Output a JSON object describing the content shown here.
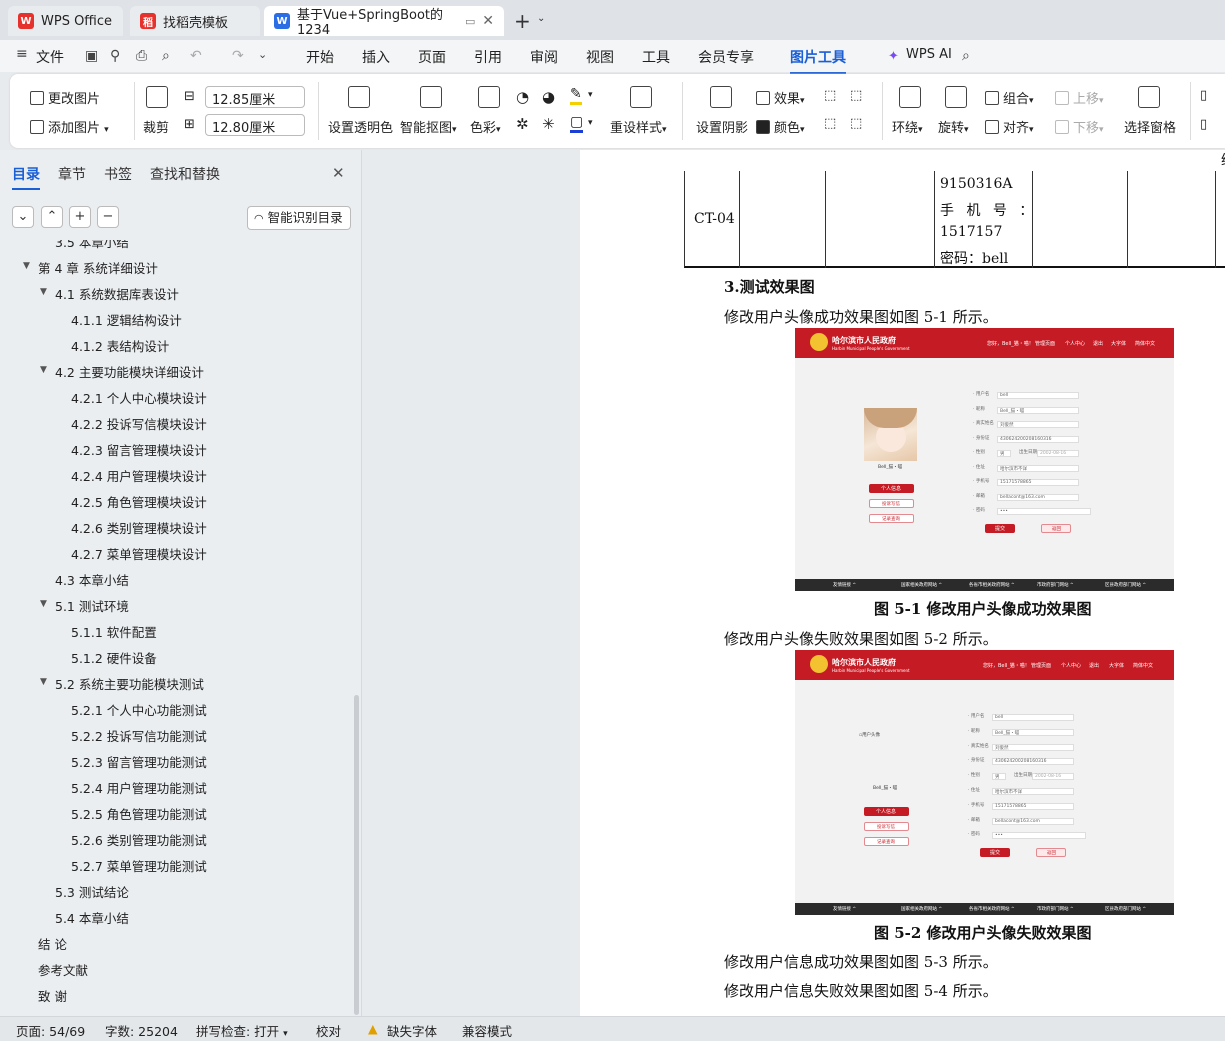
{
  "tabs": [
    {
      "label": "WPS Office"
    },
    {
      "label": "找稻壳模板"
    },
    {
      "label": "基于Vue+SpringBoot的1234"
    }
  ],
  "menu": {
    "file": "文件",
    "items": [
      "开始",
      "插入",
      "页面",
      "引用",
      "审阅",
      "视图",
      "工具",
      "会员专享",
      "图片工具"
    ],
    "active": "图片工具",
    "ai": "WPS AI"
  },
  "ribbon": {
    "change_pic": "更改图片",
    "add_pic": "添加图片",
    "crop": "裁剪",
    "width": "12.85厘米",
    "height": "12.80厘米",
    "set_transparent": "设置透明色",
    "smart_cutout": "智能抠图",
    "color": "色彩",
    "reset_style": "重设样式",
    "shadow": "设置阴影",
    "effect": "效果",
    "color2": "颜色",
    "wrap": "环绕",
    "rotate": "旋转",
    "group": "组合",
    "align": "对齐",
    "move_up": "上移",
    "move_down": "下移",
    "select_pane": "选择窗格"
  },
  "panel": {
    "tabs": [
      "目录",
      "章节",
      "书签",
      "查找和替换"
    ],
    "active_tab": "目录",
    "smart_toc": "智能识别目录",
    "toc": [
      {
        "label": "3.5 本章小结",
        "level": 2
      },
      {
        "label": "第 4 章  系统详细设计",
        "level": 1
      },
      {
        "label": "4.1 系统数据库表设计",
        "level": 2
      },
      {
        "label": "4.1.1 逻辑结构设计",
        "level": 3
      },
      {
        "label": "4.1.2 表结构设计",
        "level": 3
      },
      {
        "label": "4.2 主要功能模块详细设计",
        "level": 2
      },
      {
        "label": "4.2.1 个人中心模块设计",
        "level": 3
      },
      {
        "label": "4.2.2 投诉写信模块设计",
        "level": 3
      },
      {
        "label": "4.2.3 留言管理模块设计",
        "level": 3
      },
      {
        "label": "4.2.4 用户管理模块设计",
        "level": 3
      },
      {
        "label": "4.2.5 角色管理模块设计",
        "level": 3
      },
      {
        "label": "4.2.6 类别管理模块设计",
        "level": 3
      },
      {
        "label": "4.2.7 菜单管理模块设计",
        "level": 3
      },
      {
        "label": "4.3 本章小结",
        "level": 2
      },
      {
        "label": "5.1 测试环境",
        "level": 2
      },
      {
        "label": "5.1.1 软件配置",
        "level": 3
      },
      {
        "label": "5.1.2 硬件设备",
        "level": 3
      },
      {
        "label": "5.2 系统主要功能模块测试",
        "level": 2
      },
      {
        "label": "5.2.1 个人中心功能测试",
        "level": 3
      },
      {
        "label": "5.2.2 投诉写信功能测试",
        "level": 3
      },
      {
        "label": "5.2.3 留言管理功能测试",
        "level": 3
      },
      {
        "label": "5.2.4 用户管理功能测试",
        "level": 3
      },
      {
        "label": "5.2.5 角色管理功能测试",
        "level": 3
      },
      {
        "label": "5.2.6 类别管理功能测试",
        "level": 3
      },
      {
        "label": "5.2.7 菜单管理功能测试",
        "level": 3
      },
      {
        "label": "5.3 测试结论",
        "level": 2
      },
      {
        "label": "5.4 本章小结",
        "level": 2
      },
      {
        "label": "结  论",
        "level": 1
      },
      {
        "label": "参考文献",
        "level": 1
      },
      {
        "label": "致  谢",
        "level": 1
      }
    ]
  },
  "doc": {
    "table_row": {
      "id": "CT-04",
      "data": [
        "9150316A",
        "手 机 号 ：",
        "1517157",
        "密码：bell"
      ]
    },
    "heading": "3.测试效果图",
    "p1": "修改用户头像成功效果图如图 5-1 所示。",
    "cap1": "图 5-1 修改用户头像成功效果图",
    "p2": "修改用户头像失败效果图如图 5-2 所示。",
    "cap2": "图 5-2 修改用户头像失败效果图",
    "p3": "修改用户信息成功效果图如图 5-3 所示。",
    "p4": "修改用户信息失败效果图如图 5-4 所示。",
    "shot": {
      "site_title": "哈尔滨市人民政府",
      "site_sub": "Harbin Municipal People's Government",
      "nav": [
        "您好，Bell_猫・喵！",
        "管理页面",
        "个人中心",
        "退出",
        "大字体",
        "简体中文"
      ],
      "username": "Bell_猫・喵",
      "broken_img": "用户头像",
      "side_btns": [
        "个人信息",
        "投诉写信",
        "记录查询"
      ],
      "fields": [
        "用户名",
        "昵称",
        "真实姓名",
        "身份证",
        "性别",
        "住址",
        "手机号",
        "邮箱",
        "密码"
      ],
      "values": [
        "bell",
        "Bell_猫・喵",
        "刘俊然",
        "430624200208160316",
        "男",
        "哈尔滨市不详",
        "15171578865",
        "bellacont@163.com",
        "•••"
      ],
      "birthday": "出生日期",
      "birth_val": "2002-08-16",
      "submit": "提交",
      "back": "返回",
      "footer": [
        "友情链接",
        "国家相关政府网站",
        "各省市相关政府网站",
        "市政府部门网站",
        "区县政府部门网站"
      ]
    }
  },
  "status": {
    "page": "页面: 54/69",
    "words": "字数: 25204",
    "spell": "拼写检查: 打开",
    "proof": "校对",
    "missing_font": "缺失字体",
    "compat": "兼容模式"
  },
  "colors": {
    "accent": "#1b5fd6",
    "gov_red": "#c41b24"
  }
}
